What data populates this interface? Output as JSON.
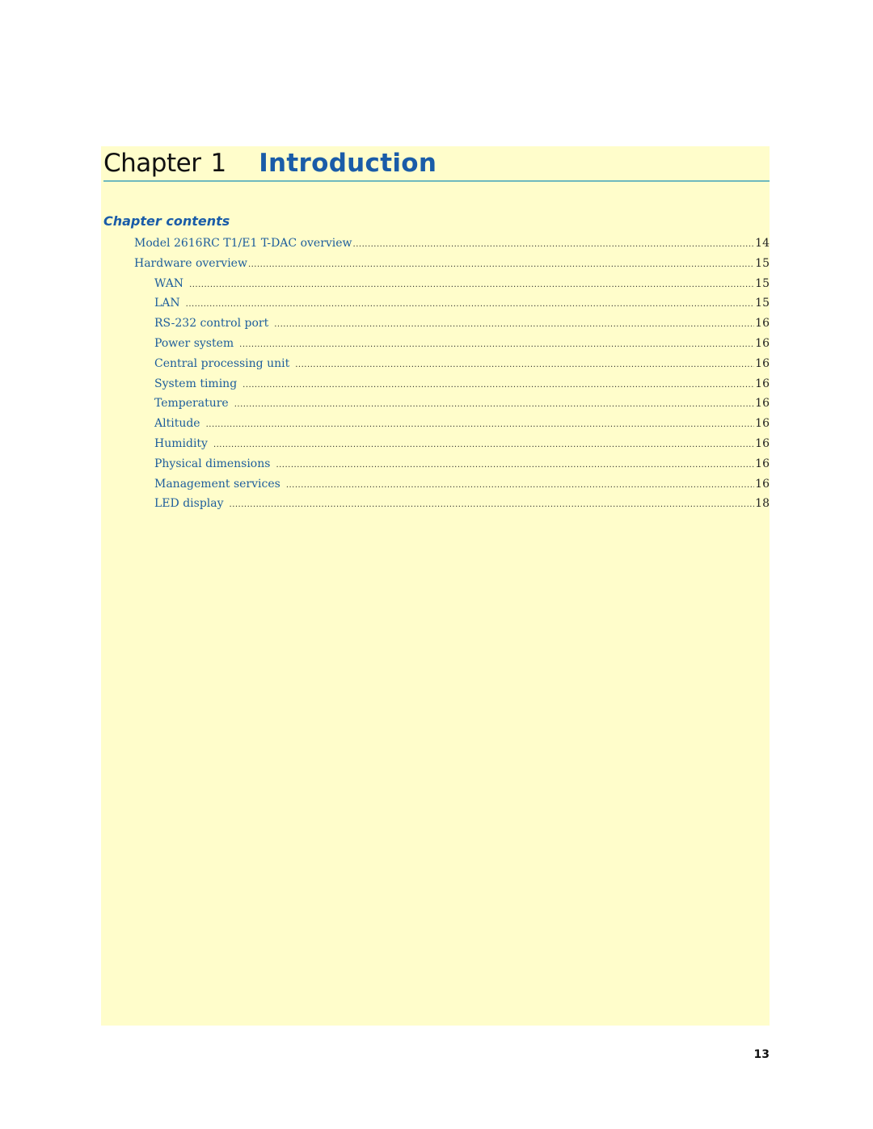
{
  "chapter": {
    "label": "Chapter",
    "number": "1",
    "title": "Introduction"
  },
  "contents_heading": "Chapter contents",
  "toc": [
    {
      "label": "Model 2616RC T1/E1 T-DAC overview",
      "page": "14",
      "level": 1
    },
    {
      "label": "Hardware overview",
      "page": "15",
      "level": 1
    },
    {
      "label": "WAN",
      "page": "15",
      "level": 2
    },
    {
      "label": "LAN",
      "page": "15",
      "level": 2
    },
    {
      "label": "RS-232 control port",
      "page": "16",
      "level": 2
    },
    {
      "label": "Power system",
      "page": "16",
      "level": 2
    },
    {
      "label": "Central processing unit",
      "page": "16",
      "level": 2
    },
    {
      "label": "System timing",
      "page": "16",
      "level": 2
    },
    {
      "label": "Temperature",
      "page": "16",
      "level": 2
    },
    {
      "label": "Altitude",
      "page": "16",
      "level": 2
    },
    {
      "label": "Humidity",
      "page": "16",
      "level": 2
    },
    {
      "label": "Physical dimensions",
      "page": "16",
      "level": 2
    },
    {
      "label": "Management services",
      "page": "16",
      "level": 2
    },
    {
      "label": "LED display",
      "page": "18",
      "level": 2
    }
  ],
  "page_number": "13",
  "colors": {
    "panel_background": "#fffdcb",
    "accent_blue": "#1a5ca8",
    "rule_teal": "#6fb9be",
    "toc_link": "#1d5d9c"
  }
}
